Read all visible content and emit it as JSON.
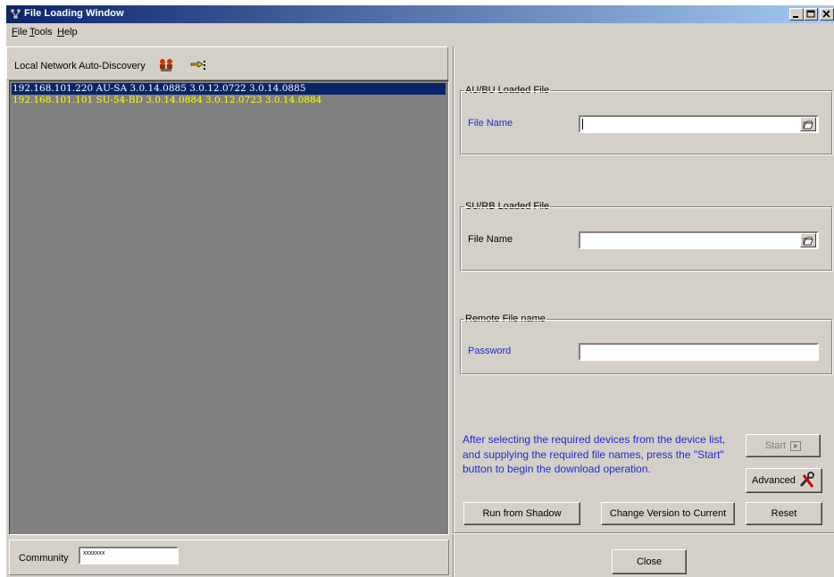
{
  "window": {
    "title": "File Loading Window"
  },
  "menu": {
    "items": [
      {
        "accel": "F",
        "rest": "ile"
      },
      {
        "accel": "T",
        "rest": "ools"
      },
      {
        "accel": "H",
        "rest": "elp"
      }
    ]
  },
  "discovery": {
    "label": "Local Network Auto-Discovery",
    "icons": [
      "network-discovery-icon",
      "pointing-hand-icon"
    ]
  },
  "devices": [
    {
      "text": "192.168.101.220 AU-SA 3.0.14.0885 3.0.12.0722 3.0.14.0885",
      "selected": true
    },
    {
      "text": "192.168.101.101 SU-54-BD 3.0.14.0884 3.0.12.0723 3.0.14.0884",
      "selected": false
    }
  ],
  "community": {
    "label": "Community",
    "value": "xxxxxxx"
  },
  "au_group": {
    "legend": "AU/BU Loaded File",
    "field_label": "File Name",
    "value": ""
  },
  "su_group": {
    "legend": "SU/RB Loaded File",
    "field_label": "File Name",
    "value": ""
  },
  "remote_group": {
    "legend": "Remote File name",
    "field_label": "Password",
    "value": ""
  },
  "info": {
    "text": "After selecting the required devices from the device list, and supplying the required file names,  press the \"Start\" button to begin the download operation."
  },
  "buttons": {
    "start": "Start",
    "advanced": "Advanced",
    "run_from_shadow": "Run from Shadow",
    "change_version": "Change Version to Current",
    "reset": "Reset",
    "close": "Close"
  },
  "colors": {
    "face": "#d4d0c8",
    "title_start": "#0a246a",
    "title_end": "#a6caf0",
    "list_bg": "#808080",
    "selected_bg": "#0a246a",
    "device_yellow": "#ffff00",
    "label_blue": "#1f2bd4"
  }
}
